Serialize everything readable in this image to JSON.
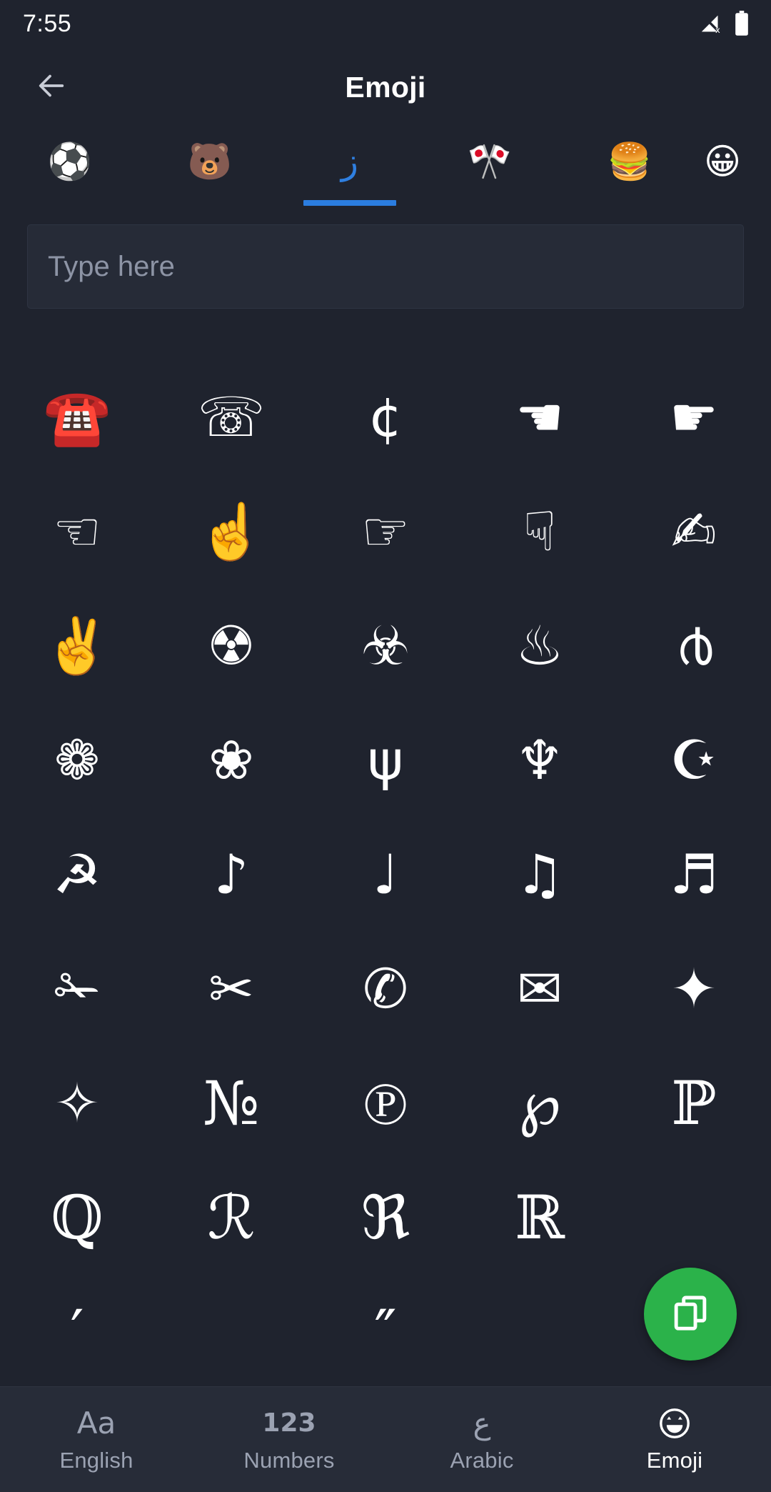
{
  "status_bar": {
    "time": "7:55",
    "signal_icon": "signal-off-icon",
    "battery_icon": "battery-full-icon"
  },
  "app_bar": {
    "back_icon": "back-arrow-icon",
    "title": "Emoji"
  },
  "category_tabs": {
    "selected_index": 2,
    "accent_color": "#2b7de0",
    "items": [
      {
        "name": "tab-activities",
        "glyph": "⚽",
        "label": "activities"
      },
      {
        "name": "tab-animals-nature",
        "glyph": "🐻",
        "label": "animals-nature"
      },
      {
        "name": "tab-symbols",
        "glyph": "ز",
        "label": "symbols"
      },
      {
        "name": "tab-flags",
        "glyph": "🎌",
        "label": "flags"
      },
      {
        "name": "tab-food-drink",
        "glyph": "🍔",
        "label": "food-drink"
      },
      {
        "name": "tab-smileys",
        "glyph": "😀",
        "label": "smileys"
      }
    ]
  },
  "search": {
    "value": "",
    "placeholder": "Type here"
  },
  "emoji_grid": {
    "columns": 5,
    "items": [
      {
        "glyph": "☎️",
        "name": "emoji-telephone"
      },
      {
        "glyph": "☏",
        "name": "emoji-white-telephone"
      },
      {
        "glyph": "¢",
        "name": "emoji-cent-sign"
      },
      {
        "glyph": "☚",
        "name": "emoji-black-left-pointing-index"
      },
      {
        "glyph": "☛",
        "name": "emoji-black-right-pointing-index"
      },
      {
        "glyph": "☜",
        "name": "emoji-white-left-pointing-index"
      },
      {
        "glyph": "☝️",
        "name": "emoji-index-pointing-up"
      },
      {
        "glyph": "☞",
        "name": "emoji-white-right-pointing-index"
      },
      {
        "glyph": "☟",
        "name": "emoji-white-down-pointing-index"
      },
      {
        "glyph": "✍",
        "name": "emoji-writing-hand"
      },
      {
        "glyph": "✌️",
        "name": "emoji-victory-hand"
      },
      {
        "glyph": "☢",
        "name": "emoji-radioactive"
      },
      {
        "glyph": "☣",
        "name": "emoji-biohazard"
      },
      {
        "glyph": "♨",
        "name": "emoji-hot-springs"
      },
      {
        "glyph": "൪",
        "name": "emoji-spiral"
      },
      {
        "glyph": "❁",
        "name": "emoji-black-florette"
      },
      {
        "glyph": "❀",
        "name": "emoji-white-florette"
      },
      {
        "glyph": "ψ",
        "name": "emoji-greek-psi"
      },
      {
        "glyph": "♆",
        "name": "emoji-neptune"
      },
      {
        "glyph": "☪",
        "name": "emoji-star-and-crescent"
      },
      {
        "glyph": "☭",
        "name": "emoji-hammer-and-sickle"
      },
      {
        "glyph": "♪",
        "name": "emoji-eighth-note"
      },
      {
        "glyph": "♩",
        "name": "emoji-quarter-note"
      },
      {
        "glyph": "♫",
        "name": "emoji-beamed-eighth-notes"
      },
      {
        "glyph": "♬",
        "name": "emoji-beamed-sixteenth-notes"
      },
      {
        "glyph": "✁",
        "name": "emoji-upper-blade-scissors"
      },
      {
        "glyph": "✂",
        "name": "emoji-black-scissors"
      },
      {
        "glyph": "✆",
        "name": "emoji-telephone-location-sign"
      },
      {
        "glyph": "✉",
        "name": "emoji-envelope"
      },
      {
        "glyph": "✦",
        "name": "emoji-black-four-pointed-star"
      },
      {
        "glyph": "✧",
        "name": "emoji-white-four-pointed-star"
      },
      {
        "glyph": "№",
        "name": "emoji-numero-sign"
      },
      {
        "glyph": "℗",
        "name": "emoji-sound-recording-copyright"
      },
      {
        "glyph": "℘",
        "name": "emoji-weierstrass-p"
      },
      {
        "glyph": "ℙ",
        "name": "emoji-double-struck-p"
      },
      {
        "glyph": "ℚ",
        "name": "emoji-double-struck-q"
      },
      {
        "glyph": "ℛ",
        "name": "emoji-script-r"
      },
      {
        "glyph": "ℜ",
        "name": "emoji-fraktur-r"
      },
      {
        "glyph": "ℝ",
        "name": "emoji-double-struck-r"
      },
      {
        "glyph": "",
        "name": "emoji-cell-empty"
      },
      {
        "glyph": "′",
        "name": "emoji-prime"
      },
      {
        "glyph": "",
        "name": "emoji-cell-empty"
      },
      {
        "glyph": "″",
        "name": "emoji-double-prime"
      },
      {
        "glyph": "",
        "name": "emoji-cell-empty"
      },
      {
        "glyph": "",
        "name": "emoji-cell-empty"
      }
    ]
  },
  "fab": {
    "name": "copy-button",
    "icon": "copy-icon",
    "color": "#2bb24a"
  },
  "bottom_nav": {
    "active_index": 3,
    "items": [
      {
        "icon_text": "Aa",
        "label": "English",
        "name": "nav-english"
      },
      {
        "icon_text": "123",
        "label": "Numbers",
        "name": "nav-numbers"
      },
      {
        "icon_text": "ع",
        "label": "Arabic",
        "name": "nav-arabic"
      },
      {
        "icon_text": "smiley-icon",
        "label": "Emoji",
        "name": "nav-emoji"
      }
    ]
  }
}
